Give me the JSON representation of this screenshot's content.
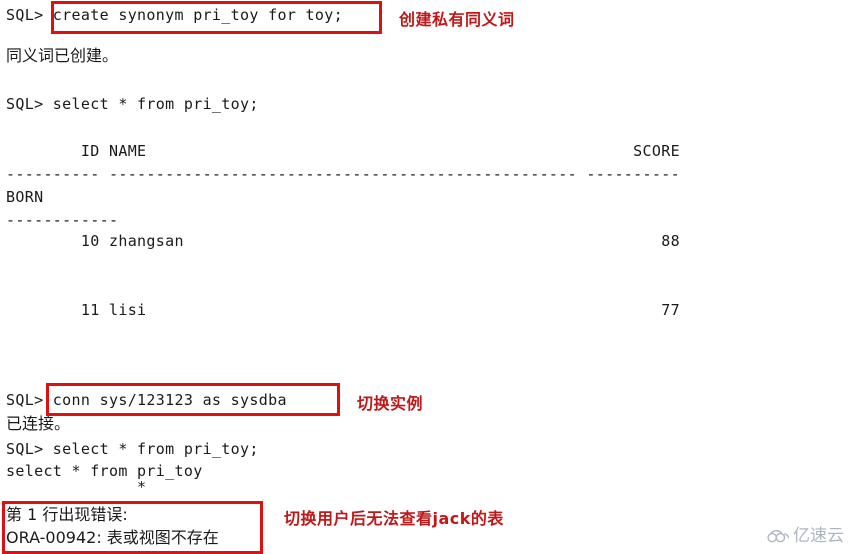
{
  "terminal": {
    "lines": [
      {
        "id": "l1",
        "text": "SQL> create synonym pri_toy for toy;"
      },
      {
        "id": "l2",
        "text": "同义词已创建。"
      },
      {
        "id": "l3",
        "text": "SQL> select * from pri_toy;"
      },
      {
        "id": "l4",
        "text": "        ID NAME                                                    SCORE"
      },
      {
        "id": "l5",
        "text": "---------- -------------------------------------------------- ----------"
      },
      {
        "id": "l6",
        "text": "BORN"
      },
      {
        "id": "l7",
        "text": "------------"
      },
      {
        "id": "l8",
        "text": "        10 zhangsan                                                   88"
      },
      {
        "id": "l9",
        "text": "        11 lisi                                                       77"
      },
      {
        "id": "l10",
        "text": "SQL> conn sys/123123 as sysdba"
      },
      {
        "id": "l11",
        "text": "已连接。"
      },
      {
        "id": "l12",
        "text": "SQL> select * from pri_toy;"
      },
      {
        "id": "l13",
        "text": "select * from pri_toy"
      },
      {
        "id": "l14",
        "text": "              *"
      },
      {
        "id": "l15",
        "text": "第 1 行出现错误:"
      },
      {
        "id": "l16",
        "text": "ORA-00942: 表或视图不存在"
      }
    ],
    "prompt": "SQL>",
    "commands": {
      "create_synonym": "create synonym pri_toy for toy;",
      "select_pri_toy": "select * from pri_toy;",
      "conn_sysdba": "conn sys/123123 as sysdba"
    },
    "results": {
      "synonym_created": "同义词已创建。",
      "connected": "已连接。",
      "error_line": "第 1 行出现错误:",
      "error_code": "ORA-00942: 表或视图不存在"
    },
    "table": {
      "columns": [
        "ID",
        "NAME",
        "SCORE",
        "BORN"
      ],
      "rows": [
        {
          "ID": "10",
          "NAME": "zhangsan",
          "SCORE": "88",
          "BORN": ""
        },
        {
          "ID": "11",
          "NAME": "lisi",
          "SCORE": "77",
          "BORN": ""
        }
      ]
    }
  },
  "annotations": [
    {
      "id": "a1",
      "text": "创建私有同义词"
    },
    {
      "id": "a2",
      "text": "切换实例"
    },
    {
      "id": "a3",
      "text": "切换用户后无法查看jack的表"
    }
  ],
  "watermark": {
    "text": "亿速云",
    "icon": "cloud-icon"
  },
  "colors": {
    "background": "#ffffff",
    "text": "#1a1a1a",
    "annotation": "#c01818",
    "box_border": "#dd1111",
    "watermark": "#a8b0bd"
  }
}
